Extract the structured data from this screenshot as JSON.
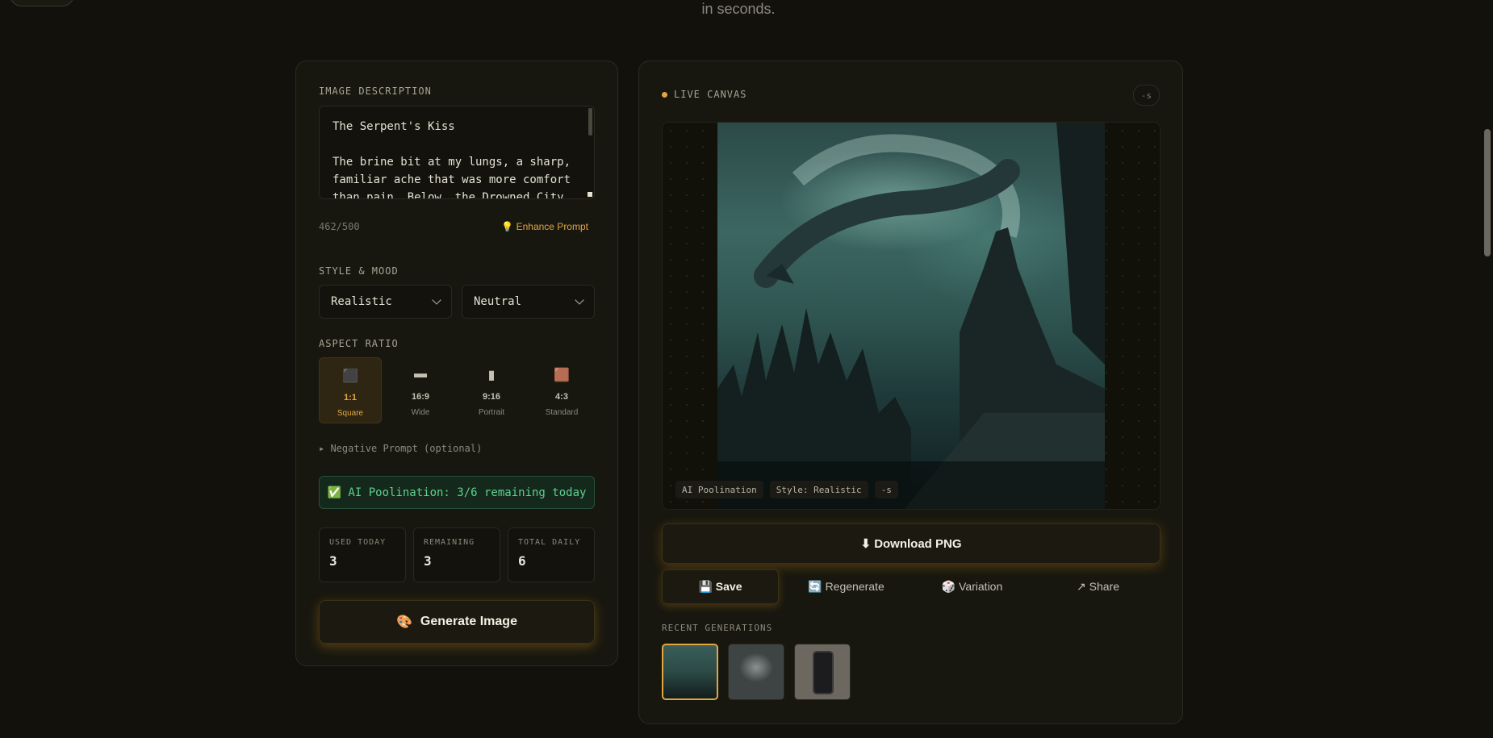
{
  "header": {
    "subtitle": "in seconds."
  },
  "left": {
    "description_label": "IMAGE DESCRIPTION",
    "description_text": "The Serpent's Kiss\n\nThe brine bit at my lungs, a sharp, familiar ache that was more comfort than pain. Below, the Drowned City",
    "char_count": "462/500",
    "enhance_label": "💡 Enhance Prompt",
    "style_label": "STYLE & MOOD",
    "style_value": "Realistic",
    "mood_value": "Neutral",
    "aspect_label": "ASPECT RATIO",
    "ratios": [
      {
        "icon": "⬛",
        "value": "1:1",
        "label": "Square"
      },
      {
        "icon": "▬",
        "value": "16:9",
        "label": "Wide"
      },
      {
        "icon": "▮",
        "value": "9:16",
        "label": "Portrait"
      },
      {
        "icon": "🟫",
        "value": "4:3",
        "label": "Standard"
      }
    ],
    "negative_prompt": "▸ Negative Prompt (optional)",
    "status": "✅ AI Poolination: 3/6 remaining today",
    "stats": [
      {
        "key": "USED TODAY",
        "value": "3"
      },
      {
        "key": "REMAINING",
        "value": "3"
      },
      {
        "key": "TOTAL DAILY",
        "value": "6"
      }
    ],
    "generate_icon": "🎨",
    "generate_label": "Generate Image"
  },
  "right": {
    "live_label": "LIVE CANVAS",
    "seed": "-s",
    "captions": [
      "AI Poolination",
      "Style: Realistic",
      "-s"
    ],
    "download_label": "⬇ Download PNG",
    "actions": [
      "💾 Save",
      "🔄 Regenerate",
      "🎲 Variation",
      "↗ Share"
    ],
    "recent_label": "RECENT GENERATIONS"
  },
  "colors": {
    "accent": "#e2a640",
    "success": "#5fd08f",
    "background": "#12110c"
  }
}
